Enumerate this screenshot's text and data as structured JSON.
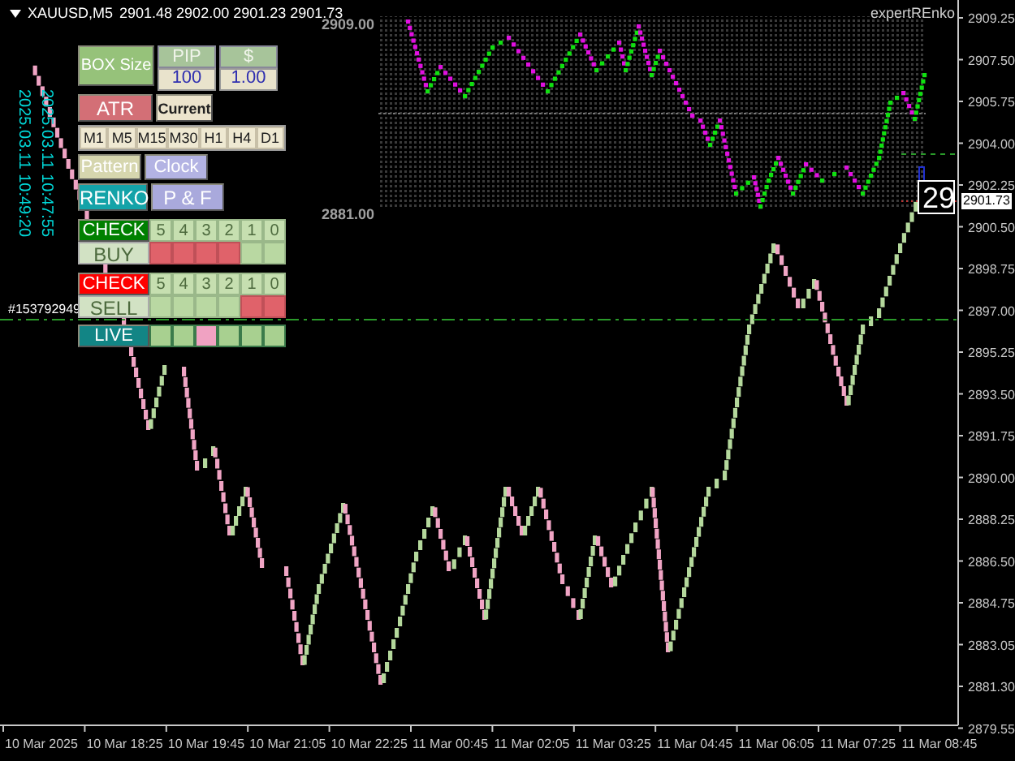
{
  "symbol_bar": {
    "symbol": "XAUUSD,M5",
    "quotes": "2901.48 2902.00 2901.23 2901.73"
  },
  "brand": "expertREnko",
  "inset": {
    "top_price": "2909.00",
    "bottom_price": "2881.00"
  },
  "price_axis": {
    "ticks": [
      "2909.25",
      "2907.50",
      "2905.75",
      "2904.00",
      "2902.25",
      "2900.50",
      "2898.75",
      "2897.00",
      "2895.25",
      "2893.50",
      "2891.75",
      "2890.00",
      "2888.25",
      "2886.50",
      "2884.75",
      "2883.05",
      "2881.30",
      "2879.55"
    ],
    "current_price": "2901.73",
    "big_label": "29"
  },
  "time_axis": {
    "ticks": [
      "10 Mar 2025",
      "10 Mar 18:25",
      "10 Mar 19:45",
      "10 Mar 21:05",
      "10 Mar 22:25",
      "11 Mar 00:45",
      "11 Mar 02:05",
      "11 Mar 03:25",
      "11 Mar 04:45",
      "11 Mar 06:05",
      "11 Mar 07:25",
      "11 Mar 08:45"
    ]
  },
  "timestamps": [
    "2025.03.11 10:49:20",
    "2025.03.11 10:47:55"
  ],
  "account": "#153792949",
  "panel": {
    "box_size": "BOX Size",
    "pip": {
      "label": "PIP",
      "value": "100"
    },
    "money": {
      "label": "$",
      "value": "1.00"
    },
    "atr": "ATR",
    "current": "Current",
    "timeframes": [
      "M1",
      "M5",
      "M15",
      "M30",
      "H1",
      "H4",
      "D1"
    ],
    "pattern": "Pattern",
    "clock": "Clock",
    "renko": "RENKO",
    "pf": "P & F",
    "check_rows": [
      {
        "check": {
          "label": "CHECK",
          "color": "#008000"
        },
        "side": "BUY",
        "levels": [
          "5",
          "4",
          "3",
          "2",
          "1",
          "0"
        ],
        "cells": [
          {
            "on": true
          },
          {
            "on": true
          },
          {
            "on": true
          },
          {
            "on": true
          },
          {
            "on": false
          },
          {
            "on": false
          }
        ]
      },
      {
        "check": {
          "label": "CHECK",
          "color": "#ff0000"
        },
        "side": "SELL",
        "levels": [
          "5",
          "4",
          "3",
          "2",
          "1",
          "0"
        ],
        "cells": [
          {
            "on": false
          },
          {
            "on": false
          },
          {
            "on": false
          },
          {
            "on": false
          },
          {
            "on": true
          },
          {
            "on": true
          }
        ]
      }
    ],
    "live": {
      "label": "LIVE",
      "cells": [
        {
          "on": false
        },
        {
          "on": false
        },
        {
          "on": true
        },
        {
          "on": false
        },
        {
          "on": false
        },
        {
          "on": false
        }
      ]
    }
  }
}
